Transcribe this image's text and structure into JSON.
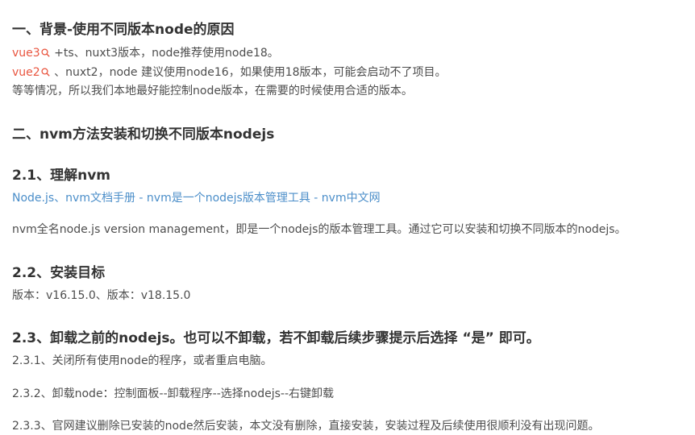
{
  "h1": "一、背景-使用不同版本node的原因",
  "vue3": {
    "keyword": "vue3",
    "text": " +ts、nuxt3版本，node推荐使用node18。"
  },
  "vue2": {
    "keyword": "vue2",
    "text": " 、nuxt2，node 建议使用node16，如果使用18版本，可能会启动不了项目。"
  },
  "p_conclusion": "等等情况，所以我们本地最好能控制node版本，在需要的时候使用合适的版本。",
  "h2": "二、nvm方法安装和切换不同版本nodejs",
  "h2_1": "2.1、理解nvm",
  "link": "Node.js、nvm文档手册 - nvm是一个nodejs版本管理工具 - nvm中文网",
  "p_nvm": "nvm全名node.js version management，即是一个nodejs的版本管理工具。通过它可以安装和切换不同版本的nodejs。",
  "h2_2": "2.2、安装目标",
  "p_versions": "版本：v16.15.0、版本：v18.15.0",
  "h2_3": "2.3、卸载之前的nodejs。也可以不卸载，若不卸载后续步骤提示后选择 “是” 即可。",
  "p_231": "2.3.1、关闭所有使用node的程序，或者重启电脑。",
  "p_232": "2.3.2、卸载node：控制面板--卸载程序--选择nodejs--右键卸载",
  "p_233": "2.3.3、官网建议删除已安装的node然后安装，本文没有删除，直接安装，安装过程及后续使用很顺利没有出现问题。",
  "colors": {
    "keyword": "#e9553f",
    "link": "#4b8ec9",
    "heading": "#333333",
    "text": "#4d4d4d"
  }
}
